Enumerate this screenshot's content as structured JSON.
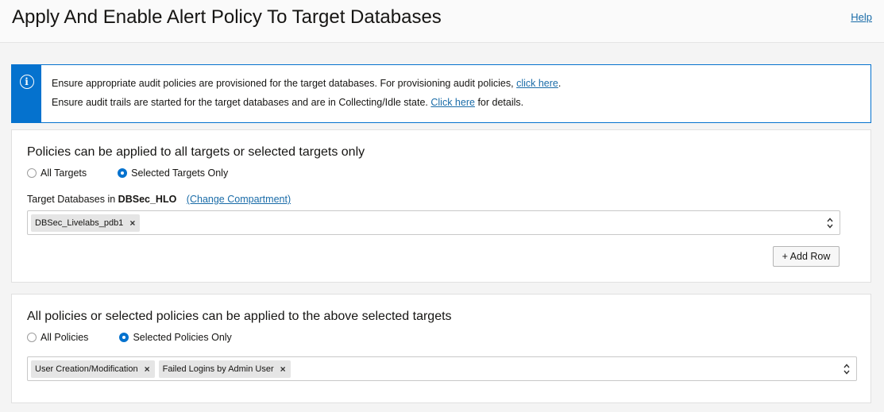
{
  "header": {
    "title": "Apply And Enable Alert Policy To Target Databases",
    "help_label": "Help"
  },
  "info_banner": {
    "icon": "info-icon",
    "line1_text": "Ensure appropriate audit policies are provisioned for the target databases. For provisioning audit policies,",
    "line1_link": "click here",
    "line1_end": ".",
    "line2_text": "Ensure audit trails are started for the target databases and are in Collecting/Idle state.",
    "line2_link": "Click here",
    "line2_end": "for details."
  },
  "targets_section": {
    "heading": "Policies can be applied to all targets or selected targets only",
    "radio_all": "All Targets",
    "radio_selected": "Selected Targets Only",
    "selected_option": "Selected Targets Only",
    "target_label_prefix": "Target Databases in",
    "compartment": "DBSec_HLO",
    "change_compartment": "(Change Compartment)",
    "chips": [
      "DBSec_Livelabs_pdb1"
    ],
    "add_row_label": "+ Add Row"
  },
  "policies_section": {
    "heading": "All policies or selected policies can be applied to the above selected targets",
    "radio_all": "All Policies",
    "radio_selected": "Selected Policies Only",
    "selected_option": "Selected Policies Only",
    "chips": [
      "User Creation/Modification",
      "Failed Logins by Admin User"
    ]
  },
  "colors": {
    "accent": "#0572ce",
    "link": "#1a6ca8"
  }
}
